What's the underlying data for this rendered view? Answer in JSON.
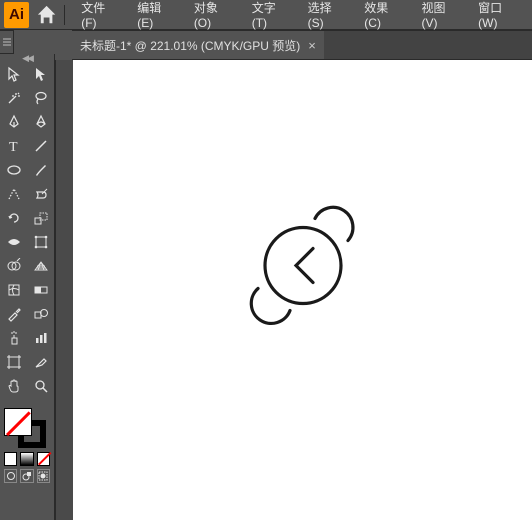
{
  "app": {
    "logo": "Ai"
  },
  "menu": {
    "items": [
      "文件(F)",
      "编辑(E)",
      "对象(O)",
      "文字(T)",
      "选择(S)",
      "效果(C)",
      "视图(V)",
      "窗口(W)"
    ]
  },
  "document": {
    "tab_title": "未标题-1* @ 221.01% (CMYK/GPU 预览)"
  },
  "tools": {
    "names": [
      "selection-tool",
      "direct-selection-tool",
      "magic-wand-tool",
      "lasso-tool",
      "pen-tool",
      "curvature-tool",
      "type-tool",
      "line-segment-tool",
      "ellipse-tool",
      "paintbrush-tool",
      "shaper-tool",
      "eraser-tool",
      "rotate-tool",
      "scale-tool",
      "width-tool",
      "free-transform-tool",
      "shape-builder-tool",
      "perspective-grid-tool",
      "mesh-tool",
      "gradient-tool",
      "eyedropper-tool",
      "blend-tool",
      "symbol-sprayer-tool",
      "column-graph-tool",
      "artboard-tool",
      "slice-tool",
      "hand-tool",
      "zoom-tool"
    ]
  },
  "swatches": {
    "fill": "none",
    "stroke": "#000000",
    "mini": [
      "#ffffff",
      "#000000",
      "none"
    ]
  }
}
